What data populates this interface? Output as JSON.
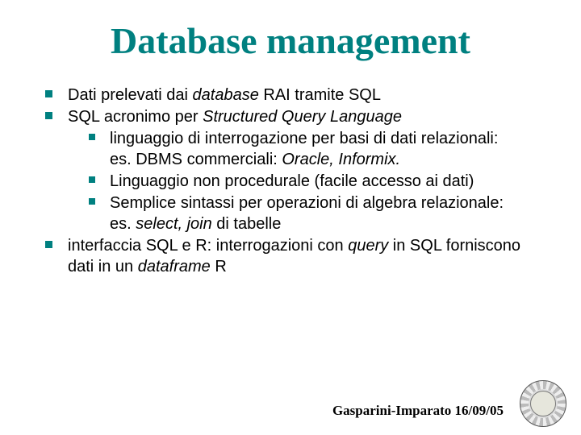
{
  "title": "Database management",
  "bullets": {
    "b1_pre": "Dati prelevati dai ",
    "b1_em": "database",
    "b1_post": " RAI tramite SQL",
    "b2_pre": "SQL acronimo per ",
    "b2_em": "Structured Query Language",
    "b2a": "linguaggio di interrogazione per basi di dati relazionali:",
    "b2a2_pre": "es. DBMS commerciali: ",
    "b2a2_em": "Oracle, Informix.",
    "b2b": "Linguaggio non procedurale (facile accesso ai dati)",
    "b2c": "Semplice sintassi per operazioni di algebra relazionale:",
    "b2c2_pre": "es. ",
    "b2c2_em": "select, join",
    "b2c2_post": " di tabelle",
    "b3_pre": "interfaccia SQL e R: interrogazioni con ",
    "b3_em": "query",
    "b3_mid": " in SQL forniscono dati in un ",
    "b3_em2": "dataframe",
    "b3_post": " R"
  },
  "footer": "Gasparini-Imparato 16/09/05"
}
